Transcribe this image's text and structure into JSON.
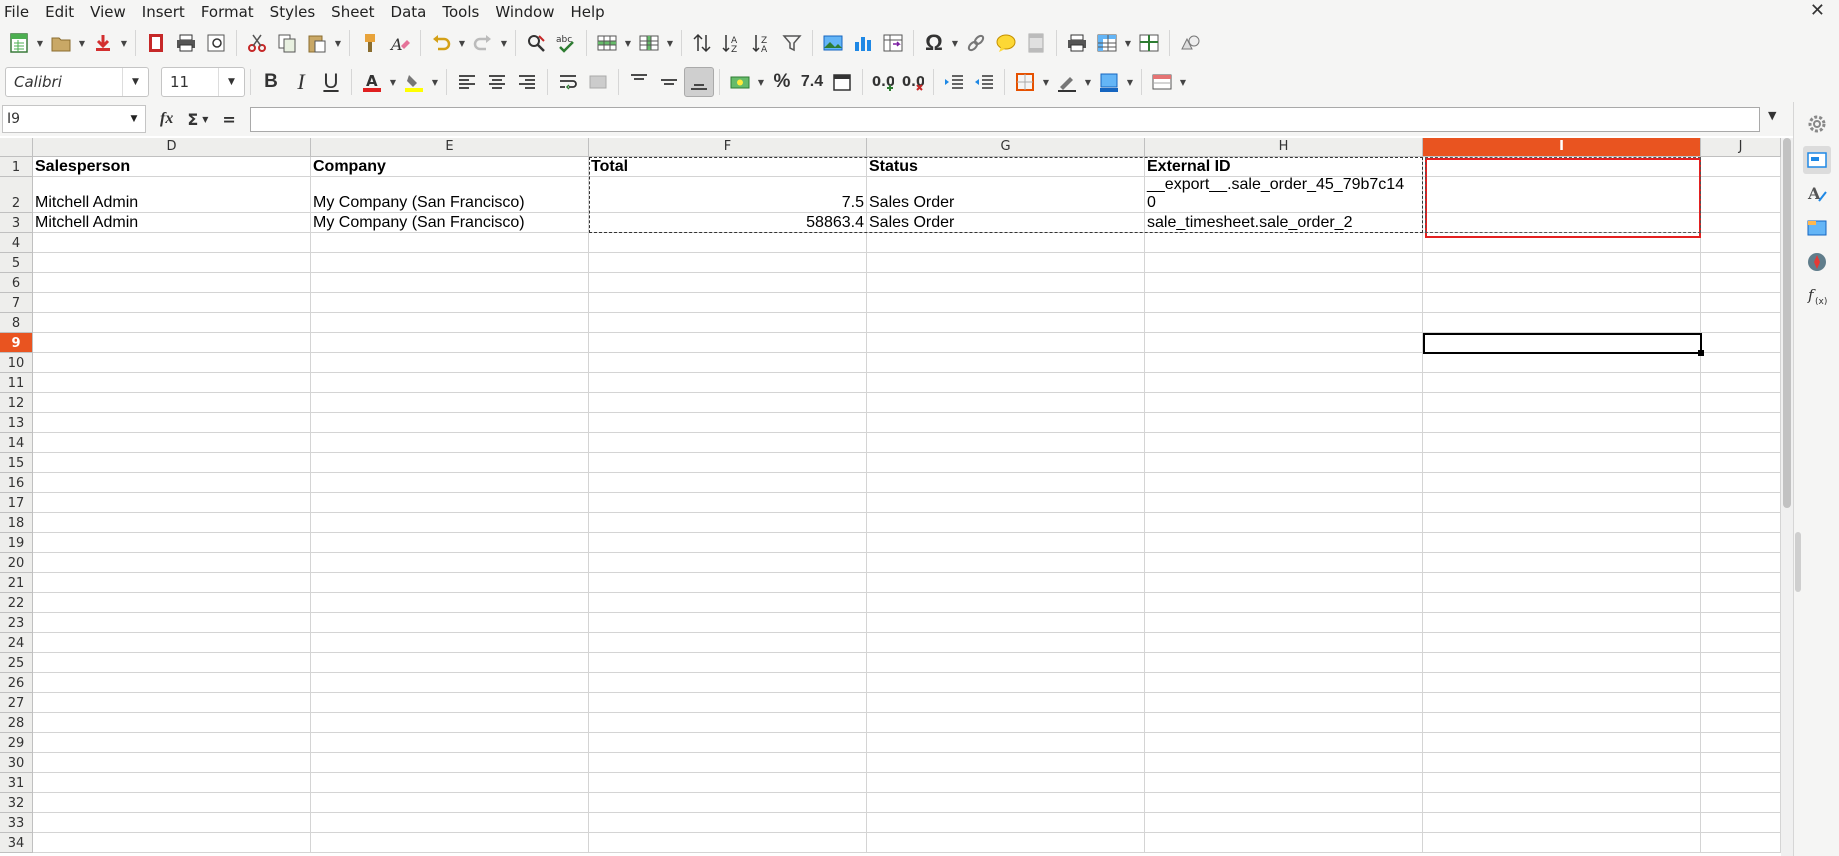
{
  "menu": [
    "File",
    "Edit",
    "View",
    "Insert",
    "Format",
    "Styles",
    "Sheet",
    "Data",
    "Tools",
    "Window",
    "Help"
  ],
  "close_glyph": "✕",
  "toolbar1": {
    "icons": [
      "new-document-icon",
      "open-folder-icon",
      "save-icon",
      "export-pdf-icon",
      "print-icon",
      "print-preview-icon",
      "cut-icon",
      "copy-icon",
      "paste-icon",
      "clone-formatting-icon",
      "clear-formatting-icon",
      "undo-icon",
      "redo-icon",
      "find-replace-icon",
      "spelling-icon",
      "row-icon",
      "column-icon",
      "sort-icon",
      "sort-ascending-icon",
      "sort-descending-icon",
      "autofilter-icon",
      "image-icon",
      "chart-icon",
      "pivot-table-icon",
      "special-character-icon",
      "hyperlink-icon",
      "comment-icon",
      "header-footer-icon",
      "define-print-area-icon",
      "freeze-rows-columns-icon",
      "split-window-icon",
      "show-draw-functions-icon"
    ]
  },
  "toolbar2": {
    "font_name": "Calibri",
    "font_size": "11",
    "bold_label": "B",
    "italic_label": "I",
    "underline_label": "U",
    "percent_label": "%",
    "number_label": "7.4",
    "colors": {
      "font_color": "#e02020",
      "highlight_color": "#ffff00",
      "accent": "#e95420"
    }
  },
  "formula_bar": {
    "cell_ref": "I9",
    "fx_label": "fx",
    "sum_label": "Σ",
    "equals_label": "=",
    "content": ""
  },
  "grid": {
    "columns": [
      "D",
      "E",
      "F",
      "G",
      "H",
      "I",
      "J"
    ],
    "active_column": "I",
    "active_row": "9",
    "rows": [
      "1",
      "2",
      "3",
      "4",
      "5",
      "6",
      "7",
      "8",
      "9",
      "10",
      "11",
      "12",
      "13",
      "14",
      "15",
      "16",
      "17",
      "18",
      "19",
      "20",
      "21",
      "22",
      "23",
      "24",
      "25",
      "26",
      "27",
      "28",
      "29",
      "30",
      "31",
      "32",
      "33",
      "34"
    ],
    "cells": {
      "D1": "Salesperson",
      "E1": "Company",
      "F1": "Total",
      "G1": "Status",
      "H1": "External ID",
      "D2": "Mitchell Admin",
      "E2": "My Company (San Francisco)",
      "F2": "7.5",
      "G2": "Sales Order",
      "H2_line1": "__export__.sale_order_45_79b7c14",
      "H2_line2": "0",
      "D3": "Mitchell Admin",
      "E3": "My Company (San Francisco)",
      "F3": "58863.4",
      "G3": "Sales Order",
      "H3": "sale_timesheet.sale_order_2"
    }
  },
  "sidebar": {
    "icons": [
      "properties-icon",
      "styles-icon",
      "gallery-icon",
      "navigator-icon",
      "functions-icon"
    ]
  }
}
